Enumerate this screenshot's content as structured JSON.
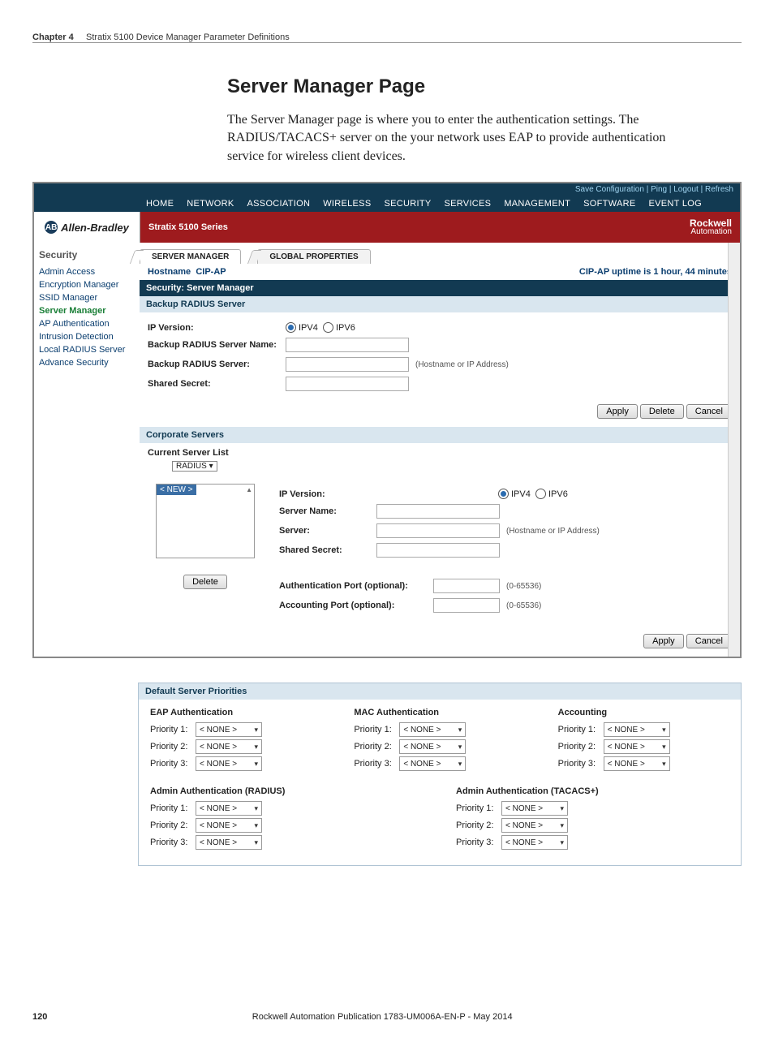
{
  "doc": {
    "chapter_label": "Chapter 4",
    "chapter_title": "Stratix 5100 Device Manager Parameter Definitions",
    "page_title": "Server Manager Page",
    "intro": "The Server Manager page is where you to enter the authentication settings. The RADIUS/TACACS+ server on the your network uses EAP to provide authentication service for wireless client devices.",
    "page_number": "120",
    "pub": "Rockwell Automation Publication 1783-UM006A-EN-P - May 2014"
  },
  "shot1": {
    "top_links": "Save Configuration  |  Ping  |  Logout  |  Refresh",
    "nav": [
      "HOME",
      "NETWORK",
      "ASSOCIATION",
      "WIRELESS",
      "SECURITY",
      "SERVICES",
      "MANAGEMENT",
      "SOFTWARE",
      "EVENT LOG"
    ],
    "brand": "Allen-Bradley",
    "series": "Stratix 5100 Series",
    "rockwell1": "Rockwell",
    "rockwell2": "Automation",
    "left_title": "Security",
    "left_items": [
      "Admin Access",
      "Encryption Manager",
      "SSID Manager",
      "Server Manager",
      "AP Authentication",
      "Intrusion Detection",
      "Local RADIUS Server",
      "Advance Security"
    ],
    "left_active_index": 3,
    "tabs": {
      "t1": "SERVER MANAGER",
      "t2": "GLOBAL PROPERTIES"
    },
    "hostname_label": "Hostname",
    "hostname": "CIP-AP",
    "uptime": "CIP-AP uptime is 1 hour, 44 minutes",
    "section_title": "Security: Server Manager",
    "backup_title": "Backup RADIUS Server",
    "labels": {
      "ip_version": "IP Version:",
      "ipv4": "IPV4",
      "ipv6": "IPV6",
      "backup_name": "Backup RADIUS Server Name:",
      "backup_server": "Backup RADIUS Server:",
      "shared_secret": "Shared Secret:",
      "host_hint": "(Hostname or IP Address)"
    },
    "btn_apply": "Apply",
    "btn_delete": "Delete",
    "btn_cancel": "Cancel",
    "corp_title": "Corporate Servers",
    "csl_title": "Current Server List",
    "csl_type": "RADIUS",
    "csl_new": "< NEW >",
    "corp_labels": {
      "ip_version": "IP Version:",
      "server_name": "Server Name:",
      "server": "Server:",
      "shared_secret": "Shared Secret:",
      "auth_port": "Authentication Port (optional):",
      "acct_port": "Accounting Port (optional):",
      "range": "(0-65536)",
      "host_hint": "(Hostname or IP Address)"
    }
  },
  "shot2": {
    "header": "Default Server Priorities",
    "groups": [
      {
        "title": "EAP Authentication",
        "p": [
          "Priority 1:",
          "Priority 2:",
          "Priority 3:"
        ]
      },
      {
        "title": "MAC Authentication",
        "p": [
          "Priority 1:",
          "Priority 2:",
          "Priority 3:"
        ]
      },
      {
        "title": "Accounting",
        "p": [
          "Priority 1:",
          "Priority 2:",
          "Priority 3:"
        ]
      }
    ],
    "groups2": [
      {
        "title": "Admin Authentication (RADIUS)",
        "p": [
          "Priority 1:",
          "Priority 2:",
          "Priority 3:"
        ]
      },
      {
        "title": "Admin Authentication (TACACS+)",
        "p": [
          "Priority 1:",
          "Priority 2:",
          "Priority 3:"
        ]
      }
    ],
    "none": "< NONE >"
  }
}
